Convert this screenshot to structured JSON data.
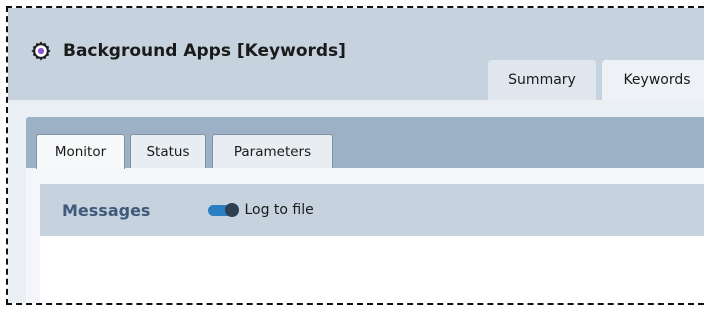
{
  "app": {
    "title": "Background Apps [Keywords]",
    "icon": "gear-icon"
  },
  "top_tabs": [
    {
      "label": "Summary",
      "active": false
    },
    {
      "label": "Keywords",
      "active": true
    }
  ],
  "sub_tabs": [
    {
      "label": "Monitor",
      "active": true
    },
    {
      "label": "Status",
      "active": false
    },
    {
      "label": "Parameters",
      "active": false
    }
  ],
  "messages": {
    "title": "Messages",
    "log_to_file": {
      "label": "Log to file",
      "enabled": true
    }
  },
  "colors": {
    "header_bg": "#c6d3df",
    "panel_bg": "#9db1c6",
    "messages_title": "#3f5a7a",
    "toggle_on": "#2a7ec2"
  }
}
